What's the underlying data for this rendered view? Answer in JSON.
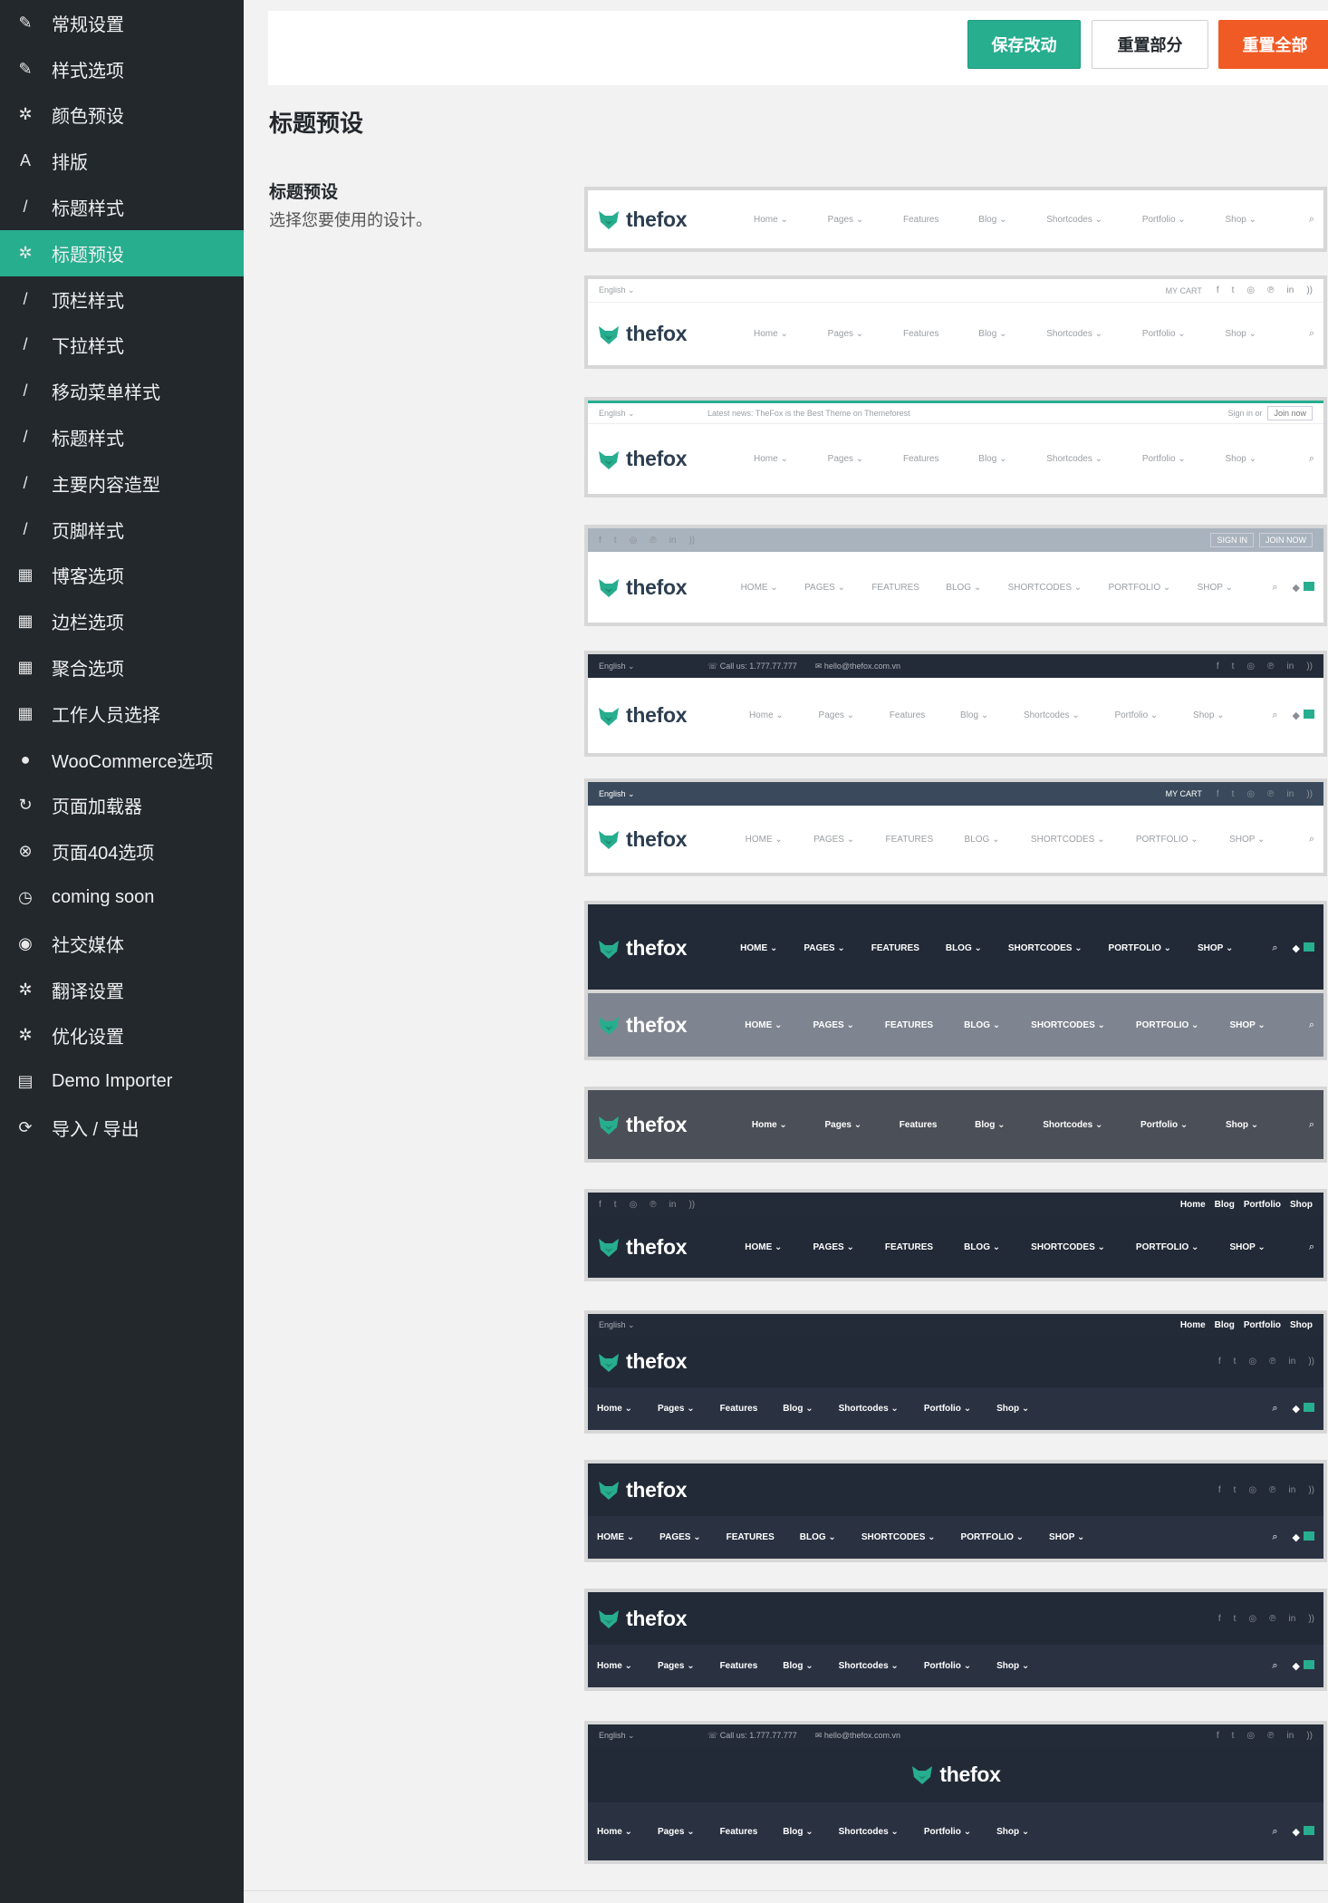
{
  "sidebar": {
    "items": [
      {
        "icon": "edit-icon",
        "glyph": "✎",
        "label": "常规设置"
      },
      {
        "icon": "edit-icon",
        "glyph": "✎",
        "label": "样式选项"
      },
      {
        "icon": "gear-icon",
        "glyph": "✲",
        "label": "颜色预设"
      },
      {
        "icon": "font-icon",
        "glyph": "A",
        "label": "排版"
      },
      {
        "icon": "brush-icon",
        "glyph": "/",
        "label": "标题样式"
      },
      {
        "icon": "gear-icon",
        "glyph": "✲",
        "label": "标题预设"
      },
      {
        "icon": "brush-icon",
        "glyph": "/",
        "label": "顶栏样式"
      },
      {
        "icon": "brush-icon",
        "glyph": "/",
        "label": "下拉样式"
      },
      {
        "icon": "brush-icon",
        "glyph": "/",
        "label": "移动菜单样式"
      },
      {
        "icon": "brush-icon",
        "glyph": "/",
        "label": "标题样式"
      },
      {
        "icon": "brush-icon",
        "glyph": "/",
        "label": "主要内容造型"
      },
      {
        "icon": "brush-icon",
        "glyph": "/",
        "label": "页脚样式"
      },
      {
        "icon": "grid-icon",
        "glyph": "▦",
        "label": "博客选项"
      },
      {
        "icon": "grid-icon",
        "glyph": "▦",
        "label": "边栏选项"
      },
      {
        "icon": "grid-icon",
        "glyph": "▦",
        "label": "聚合选项"
      },
      {
        "icon": "grid-icon",
        "glyph": "▦",
        "label": "工作人员选择"
      },
      {
        "icon": "woocommerce-icon",
        "glyph": "●",
        "label": "WooCommerce选项"
      },
      {
        "icon": "refresh-icon",
        "glyph": "↻",
        "label": "页面加载器"
      },
      {
        "icon": "close-circle-icon",
        "glyph": "⊗",
        "label": "页面404选项"
      },
      {
        "icon": "clock-icon",
        "glyph": "◷",
        "label": "coming soon"
      },
      {
        "icon": "globe-icon",
        "glyph": "◉",
        "label": "社交媒体"
      },
      {
        "icon": "gear-icon",
        "glyph": "✲",
        "label": "翻译设置"
      },
      {
        "icon": "gear-icon",
        "glyph": "✲",
        "label": "优化设置"
      },
      {
        "icon": "list-icon",
        "glyph": "▤",
        "label": "Demo Importer"
      },
      {
        "icon": "sync-icon",
        "glyph": "⟳",
        "label": "导入 / 导出"
      }
    ],
    "active_index": 5
  },
  "toolbar": {
    "save_label": "保存改动",
    "reset_section_label": "重置部分",
    "reset_all_label": "重置全部"
  },
  "section": {
    "title": "标题预设"
  },
  "field": {
    "title": "标题预设",
    "description": "选择您要使用的设计。"
  },
  "logo_text": "thefox",
  "menu_items": [
    "Home",
    "Pages",
    "Features",
    "Blog",
    "Shortcodes",
    "Portfolio",
    "Shop"
  ],
  "menu_items_upper": [
    "HOME",
    "PAGES",
    "FEATURES",
    "BLOG",
    "SHORTCODES",
    "PORTFOLIO",
    "SHOP"
  ],
  "topbar_texts": {
    "language": "English",
    "my_cart": "MY CART",
    "latest_news_label": "Latest news:",
    "latest_news_text": "TheFox is the Best Theme on Themeforest",
    "sign_in": "Sign in or",
    "join_now": "Join now",
    "sign_in_upper": "SIGN IN",
    "join_now_upper": "JOIN NOW",
    "call_us": "Call us: 1.777.77.777",
    "email": "hello@thefox.com.vn"
  },
  "presets": [
    {
      "style": "light"
    },
    {
      "style": "light"
    },
    {
      "style": "light"
    },
    {
      "style": "light"
    },
    {
      "style": "light"
    },
    {
      "style": "light"
    },
    {
      "style": "dark"
    },
    {
      "style": "gray"
    },
    {
      "style": "darkgray"
    },
    {
      "style": "dark"
    },
    {
      "style": "dark"
    },
    {
      "style": "dark"
    },
    {
      "style": "dark"
    },
    {
      "style": "dark"
    }
  ],
  "colors": {
    "accent": "#27ae8f",
    "danger": "#f05a24",
    "sidebar_bg": "#23282d",
    "dark_header": "#222a37"
  }
}
